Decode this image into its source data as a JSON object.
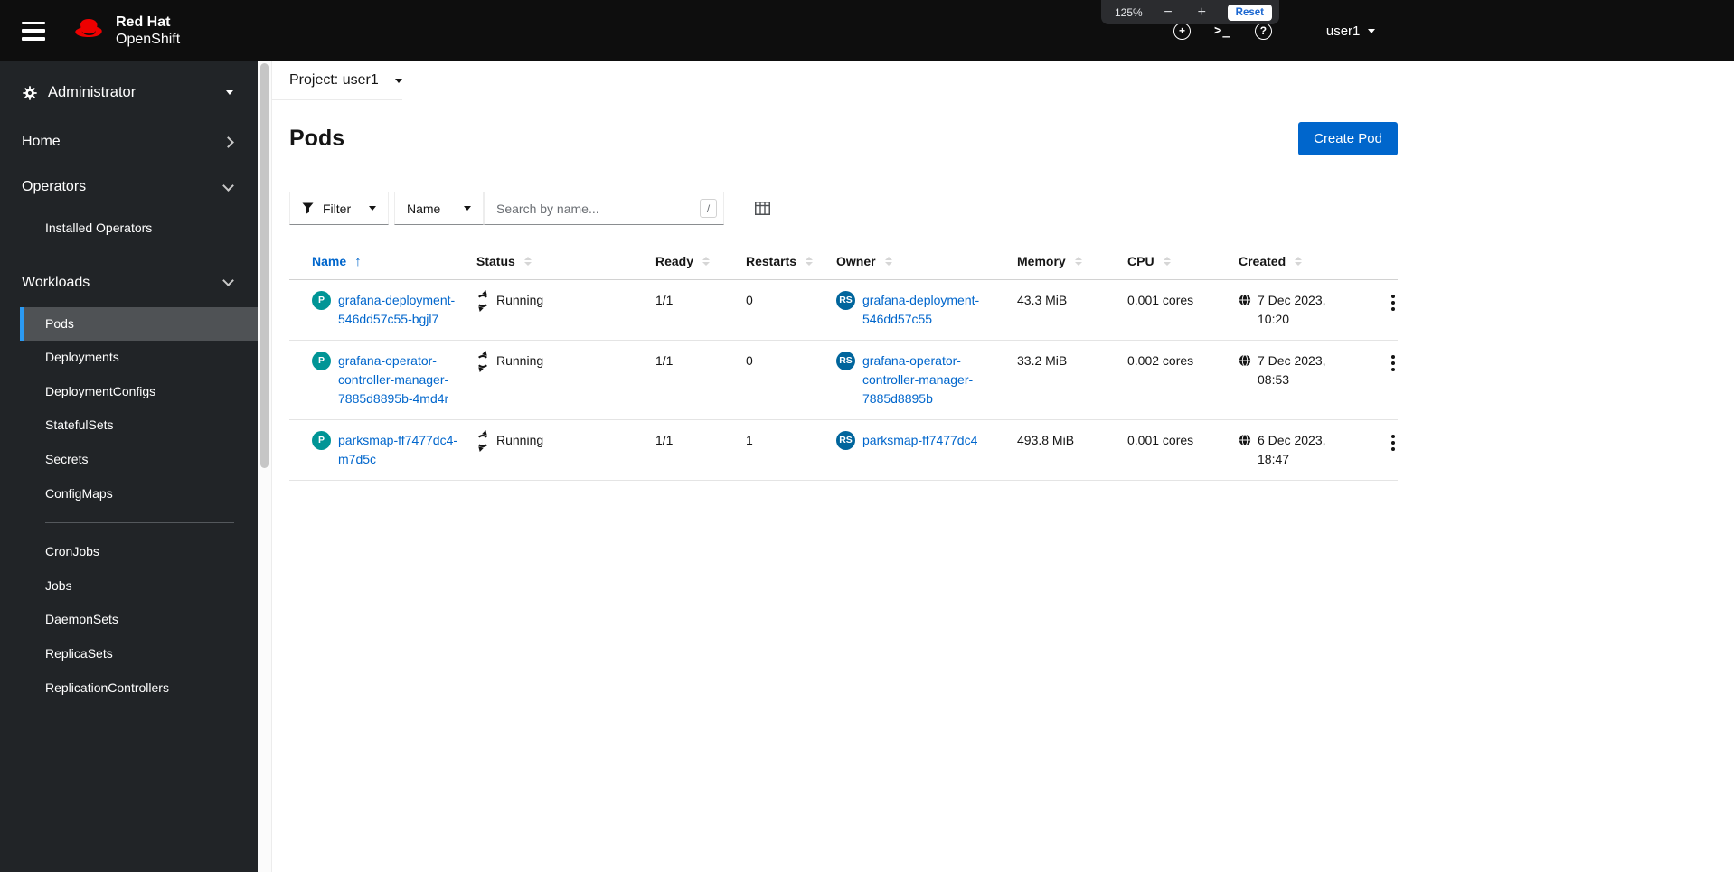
{
  "masthead": {
    "brand_line1": "Red Hat",
    "brand_line2": "OpenShift",
    "user_label": "user1",
    "zoom": {
      "level": "125%",
      "minus": "−",
      "plus": "+",
      "reset": "Reset"
    },
    "icons": {
      "first": "plus-circle",
      "second": "terminal",
      "third": "help-circle"
    },
    "terminal_glyph": ">_",
    "plus_glyph": "+",
    "help_glyph": "?"
  },
  "sidebar": {
    "perspective": "Administrator",
    "home": "Home",
    "operators": "Operators",
    "installed_operators": "Installed Operators",
    "workloads": "Workloads",
    "items": [
      "Pods",
      "Deployments",
      "DeploymentConfigs",
      "StatefulSets",
      "Secrets",
      "ConfigMaps",
      "CronJobs",
      "Jobs",
      "DaemonSets",
      "ReplicaSets",
      "ReplicationControllers"
    ]
  },
  "project_bar": {
    "label": "Project: user1"
  },
  "page": {
    "title": "Pods",
    "create_button": "Create Pod"
  },
  "toolbar": {
    "filter": "Filter",
    "attribute": "Name",
    "search_placeholder": "Search by name...",
    "shortcut": "/"
  },
  "table": {
    "headers": {
      "name": "Name",
      "status": "Status",
      "ready": "Ready",
      "restarts": "Restarts",
      "owner": "Owner",
      "memory": "Memory",
      "cpu": "CPU",
      "created": "Created"
    },
    "rows": [
      {
        "badge": "P",
        "name": "grafana-deployment-546dd57c55-bgjl7",
        "status": "Running",
        "ready": "1/1",
        "restarts": "0",
        "owner_badge": "RS",
        "owner": "grafana-deployment-546dd57c55",
        "memory": "43.3 MiB",
        "cpu": "0.001 cores",
        "created": "7 Dec 2023, 10:20"
      },
      {
        "badge": "P",
        "name": "grafana-operator-controller-manager-7885d8895b-4md4r",
        "status": "Running",
        "ready": "1/1",
        "restarts": "0",
        "owner_badge": "RS",
        "owner": "grafana-operator-controller-manager-7885d8895b",
        "memory": "33.2 MiB",
        "cpu": "0.002 cores",
        "created": "7 Dec 2023, 08:53"
      },
      {
        "badge": "P",
        "name": "parksmap-ff7477dc4-m7d5c",
        "status": "Running",
        "ready": "1/1",
        "restarts": "1",
        "owner_badge": "RS",
        "owner": "parksmap-ff7477dc4",
        "memory": "493.8 MiB",
        "cpu": "0.001 cores",
        "created": "6 Dec 2023, 18:47"
      }
    ]
  }
}
